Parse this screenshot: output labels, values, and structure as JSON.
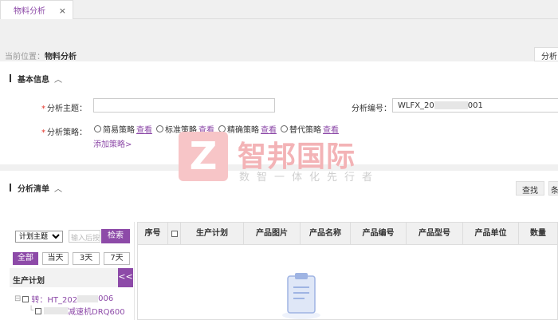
{
  "tabs": [
    {
      "label": "物料分析",
      "close": "×"
    }
  ],
  "breadcrumb": {
    "prefix": "当前位置：",
    "page": "物料分析"
  },
  "header_right_button": "分析",
  "basic_section": {
    "title": "基本信息",
    "caret": "︿",
    "subject_label": "分析主题：",
    "subject_value": "",
    "code_label": "分析编号：",
    "code_prefix": "WLFX_20",
    "code_suffix": "001",
    "strategy_label": "分析策略：",
    "strategies": [
      {
        "label": "简易策略",
        "view": "查看"
      },
      {
        "label": "标准策略",
        "view": "查看"
      },
      {
        "label": "精确策略",
        "view": "查看"
      },
      {
        "label": "替代策略",
        "view": "查看"
      }
    ],
    "add_strategy": "添加策略>"
  },
  "watermark": {
    "logo": "Z",
    "title": "智邦国际",
    "subtitle": "数智一体化先行者"
  },
  "list_section": {
    "title": "分析清单",
    "caret": "︿",
    "query_button": "查找",
    "right_button": "条"
  },
  "left_filter": {
    "select_value": "计划主题",
    "select_options": [
      "计划主题"
    ],
    "keyword_placeholder": "输入后按回",
    "search_button": "检索",
    "filters": [
      "全部",
      "当天",
      "3天",
      "7天"
    ],
    "tree_title": "生产计划",
    "collapse": "<<",
    "tree": [
      {
        "prefix": "转：HT_202",
        "suffix": "006"
      },
      {
        "prefix": "",
        "suffix": "减速机DRQ600"
      }
    ]
  },
  "table": {
    "columns": [
      "序号",
      "",
      "生产计划",
      "产品图片",
      "产品名称",
      "产品编号",
      "产品型号",
      "产品单位",
      "数量"
    ]
  },
  "colors": {
    "accent": "#8d4aa8",
    "required": "#e3352b"
  }
}
